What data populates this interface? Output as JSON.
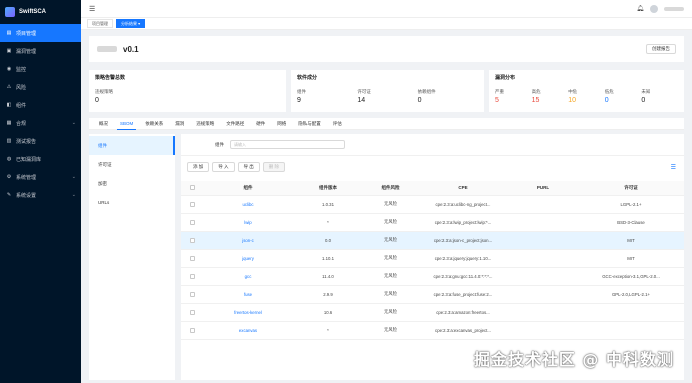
{
  "app": {
    "name": "SwiftSCA"
  },
  "sidebar": {
    "items": [
      {
        "label": "项目管理",
        "icon": "folder-icon",
        "active": true,
        "caret": false
      },
      {
        "label": "漏洞管理",
        "icon": "bug-icon",
        "active": false,
        "caret": false
      },
      {
        "label": "监控",
        "icon": "monitor-icon",
        "active": false,
        "caret": false
      },
      {
        "label": "风险",
        "icon": "risk-icon",
        "active": false,
        "caret": false
      },
      {
        "label": "组件",
        "icon": "component-icon",
        "active": false,
        "caret": false
      },
      {
        "label": "合规",
        "icon": "compliance-icon",
        "active": false,
        "caret": true
      },
      {
        "label": "测试报告",
        "icon": "report-icon",
        "active": false,
        "caret": false
      },
      {
        "label": "已知漏洞库",
        "icon": "database-icon",
        "active": false,
        "caret": false
      },
      {
        "label": "系统管理",
        "icon": "system-icon",
        "active": false,
        "caret": true
      },
      {
        "label": "系统设置",
        "icon": "settings-icon",
        "active": false,
        "caret": true
      }
    ]
  },
  "tabs": [
    {
      "label": "项目管理",
      "active": false
    },
    {
      "label": "分析结果 ▾",
      "active": true
    }
  ],
  "project": {
    "version": "v0.1",
    "report_button": "创建报告"
  },
  "stats": {
    "policy": {
      "title": "策略告警总数",
      "cells": [
        {
          "label": "违规策略",
          "value": "0"
        }
      ]
    },
    "components": {
      "title": "软件成分",
      "cells": [
        {
          "label": "组件",
          "value": "9"
        },
        {
          "label": "许可证",
          "value": "14"
        },
        {
          "label": "依赖组件",
          "value": "0"
        }
      ]
    },
    "vulns": {
      "title": "漏洞分布",
      "cells": [
        {
          "label": "严重",
          "value": "5",
          "color": "#e8483b"
        },
        {
          "label": "高危",
          "value": "15",
          "color": "#e8483b"
        },
        {
          "label": "中危",
          "value": "10",
          "color": "#f5a623"
        },
        {
          "label": "低危",
          "value": "0",
          "color": "#1677ff"
        },
        {
          "label": "未知",
          "value": "0",
          "color": "#222222"
        }
      ]
    }
  },
  "sub_tabs": [
    "概况",
    "SBOM",
    "依赖关系",
    "漏洞",
    "违规策略",
    "文件路径",
    "硬件",
    "网络",
    "隐私与配置",
    "评估"
  ],
  "side_list": [
    "组件",
    "许可证",
    "加密",
    "URLs"
  ],
  "search": {
    "label": "组件",
    "placeholder": "请输入"
  },
  "toolbar": {
    "add": "添 加",
    "import": "导 入",
    "export": "导 出",
    "delete": "删 除"
  },
  "table": {
    "columns": [
      "组件",
      "组件版本",
      "组件风险",
      "CPE",
      "PURL",
      "许可证"
    ],
    "rows": [
      {
        "name": "uclibc",
        "version": "1.0.31",
        "risk": "无风险",
        "cpe": "cpe:2.3:a:uclibc-ng_project...",
        "purl": "",
        "license": "LGPL-2.1+"
      },
      {
        "name": "lwip",
        "version": "*",
        "risk": "无风险",
        "cpe": "cpe:2.3:a:lwip_project:lwip:*...",
        "purl": "",
        "license": "BSD-3-Clause"
      },
      {
        "name": "json-c",
        "version": "0.0",
        "risk": "无风险",
        "cpe": "cpe:2.3:a:json-c_project:json...",
        "purl": "",
        "license": "MIT"
      },
      {
        "name": "jquery",
        "version": "1.10.1",
        "risk": "无风险",
        "cpe": "cpe:2.3:a:jquery:jquery:1.10...",
        "purl": "",
        "license": "MIT"
      },
      {
        "name": "gcc",
        "version": "11.4.0",
        "risk": "无风险",
        "cpe": "cpe:2.3:a:gnu:gcc:11.4.0:*:*:*...",
        "purl": "",
        "license": "GCC-exception-3.1,GPL-2.0..."
      },
      {
        "name": "fuse",
        "version": "2.9.9",
        "risk": "无风险",
        "cpe": "cpe:2.3:a:fuse_project:fuse:2...",
        "purl": "",
        "license": "GPL-2.0,LGPL-2.1+"
      },
      {
        "name": "freertos-kernel",
        "version": "10.6",
        "risk": "无风险",
        "cpe": "cpe:2.3:a:amazon:freertos...",
        "purl": "",
        "license": ""
      },
      {
        "name": "excanvas",
        "version": "*",
        "risk": "无风险",
        "cpe": "cpe:2.3:a:excanvas_project...",
        "purl": "",
        "license": ""
      }
    ],
    "highlight_row": 2
  },
  "watermark": "掘金技术社区 @ 中科数测"
}
